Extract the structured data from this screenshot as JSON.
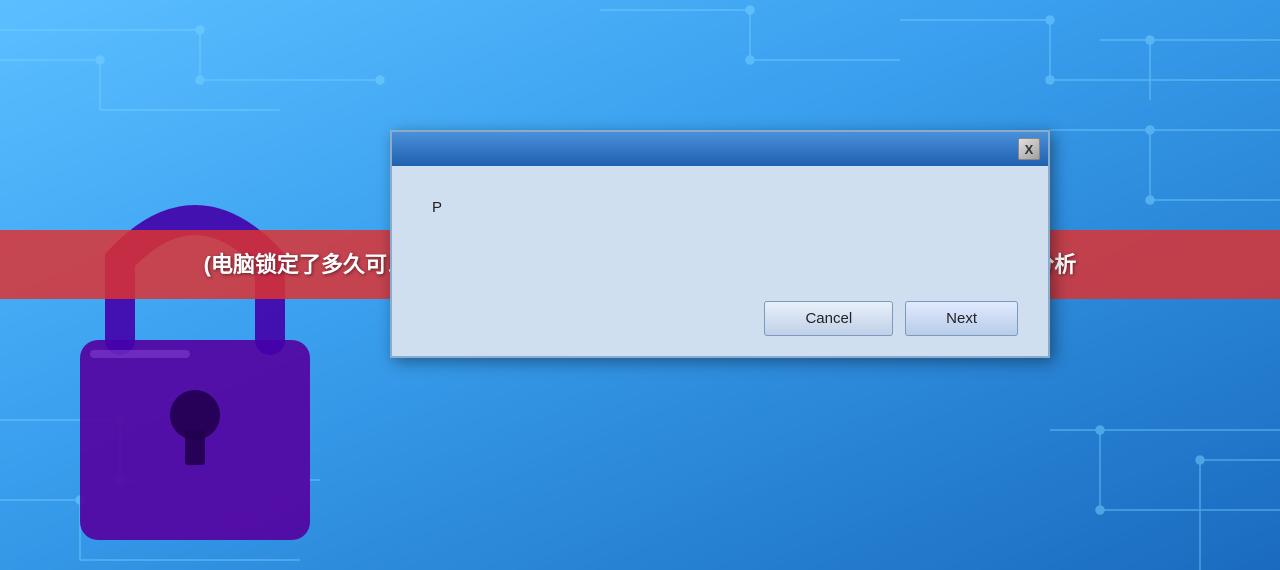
{
  "background": {
    "alt": "blue circuit board with lock"
  },
  "title_overlay": {
    "text": "(电脑锁定了多久可以解锁啊)电脑锁定时间解析，多久可以解锁，常见问题解答及深度分析"
  },
  "dialog": {
    "close_button_label": "X",
    "content_text": "P",
    "cancel_button_label": "Cancel",
    "next_button_label": "Next"
  }
}
